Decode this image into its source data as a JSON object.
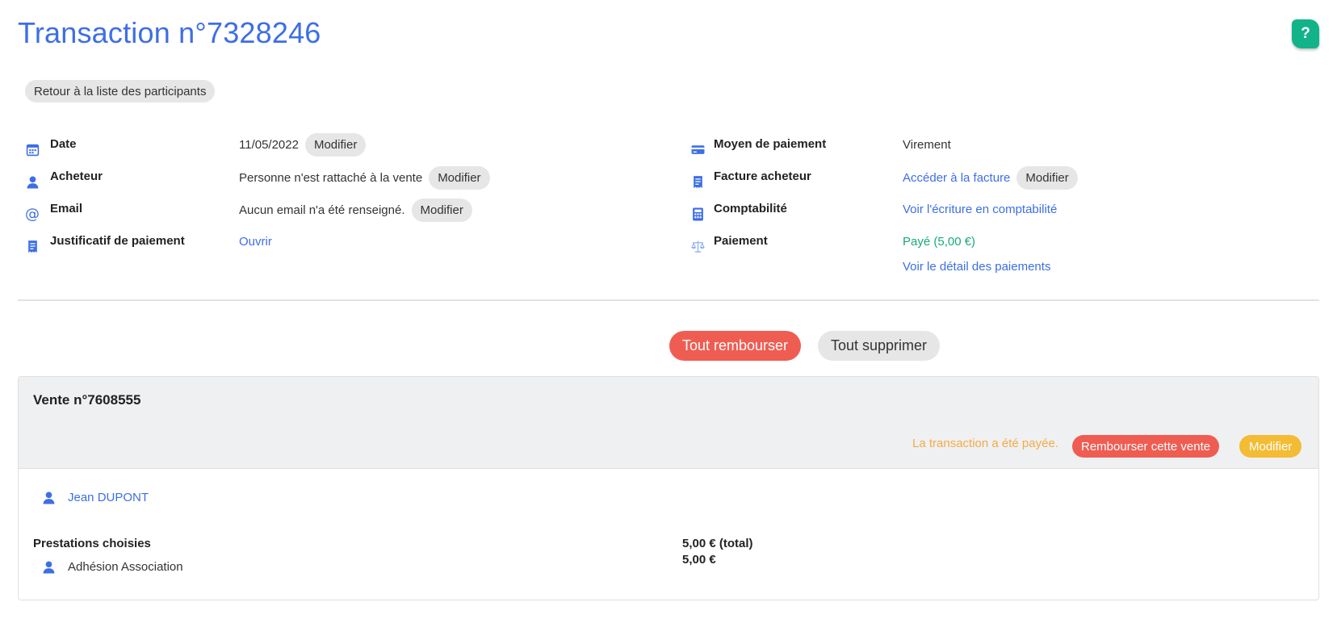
{
  "header": {
    "title": "Transaction n°7328246",
    "help_label": "?",
    "back_label": "Retour à la liste des participants"
  },
  "left_info": {
    "date": {
      "label": "Date",
      "value": "11/05/2022",
      "action": "Modifier"
    },
    "buyer": {
      "label": "Acheteur",
      "value": "Personne n'est rattaché à la vente",
      "action": "Modifier"
    },
    "email": {
      "label": "Email",
      "value": "Aucun email n'a été renseigné.",
      "action": "Modifier"
    },
    "receipt": {
      "label": "Justificatif de paiement",
      "link": "Ouvrir"
    }
  },
  "right_info": {
    "payment_method": {
      "label": "Moyen de paiement",
      "value": "Virement"
    },
    "invoice": {
      "label": "Facture acheteur",
      "link": "Accéder à la facture",
      "action": "Modifier"
    },
    "accounting": {
      "label": "Comptabilité",
      "link": "Voir l'écriture en comptabilité"
    },
    "payment": {
      "label": "Paiement",
      "status": "Payé (5,00 €)",
      "link": "Voir le détail des paiements"
    }
  },
  "actions": {
    "refund_all": "Tout rembourser",
    "delete_all": "Tout supprimer"
  },
  "sale": {
    "title": "Vente n°7608555",
    "paid_note": "La transaction a été payée.",
    "refund_label": "Rembourser cette vente",
    "edit_label": "Modifier",
    "person_name": "Jean DUPONT",
    "section_label": "Prestations choisies",
    "item_name": "Adhésion Association",
    "total": "5,00 € (total)",
    "item_amount": "5,00 €"
  },
  "colors": {
    "accent": "#3d6ee5",
    "help": "#13b38a",
    "danger": "#ef5d52",
    "warning": "#f4bc34",
    "paid_green": "#19a87a"
  }
}
